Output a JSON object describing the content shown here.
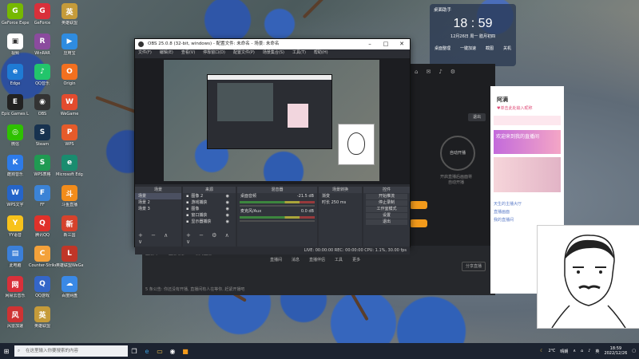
{
  "desktop_icons": [
    {
      "label": "GeForce Experience",
      "color": "#76b900",
      "glyph": "G"
    },
    {
      "label": "GeForce",
      "color": "#d9303a",
      "glyph": "G"
    },
    {
      "label": "英雄联盟",
      "color": "#c59b3a",
      "glyph": "英"
    },
    {
      "label": "视频",
      "color": "#ffffff",
      "glyph": "▣"
    },
    {
      "label": "WinRAR",
      "color": "#8b4b9e",
      "glyph": "R"
    },
    {
      "label": "应用宝",
      "color": "#2f8ce0",
      "glyph": "▶"
    },
    {
      "label": "Edge",
      "color": "#1f7bd4",
      "glyph": "e"
    },
    {
      "label": "QQ音乐",
      "color": "#22c56b",
      "glyph": "♪"
    },
    {
      "label": "Origin",
      "color": "#f3701f",
      "glyph": "O"
    },
    {
      "label": "Epic Games Launcher",
      "color": "#222222",
      "glyph": "E"
    },
    {
      "label": "OBS",
      "color": "#333333",
      "glyph": "◉"
    },
    {
      "label": "WeGame",
      "color": "#e34b2e",
      "glyph": "W"
    },
    {
      "label": "微信",
      "color": "#2ec100",
      "glyph": "◎"
    },
    {
      "label": "Steam",
      "color": "#17324f",
      "glyph": "S"
    },
    {
      "label": "WPS",
      "color": "#e65b2a",
      "glyph": "P"
    },
    {
      "label": "酷狗音乐",
      "color": "#2d7be8",
      "glyph": "K"
    },
    {
      "label": "WPS表格",
      "color": "#1f9a52",
      "glyph": "S"
    },
    {
      "label": "Microsoft Edge",
      "color": "#1a8c6f",
      "glyph": "e"
    },
    {
      "label": "WPS文字",
      "color": "#2565c9",
      "glyph": "W"
    },
    {
      "label": "FF",
      "color": "#3b83d6",
      "glyph": "F"
    },
    {
      "label": "斗鱼直播",
      "color": "#f28c1b",
      "glyph": "斗"
    },
    {
      "label": "YY语音",
      "color": "#f7c21b",
      "glyph": "Y"
    },
    {
      "label": "腾讯QQ",
      "color": "#e0312a",
      "glyph": "Q"
    },
    {
      "label": "新三国",
      "color": "#d5422c",
      "glyph": "新"
    },
    {
      "label": "此电脑",
      "color": "#3b7fd8",
      "glyph": "▤"
    },
    {
      "label": "Counter-Strike",
      "color": "#f3a13a",
      "glyph": "C"
    },
    {
      "label": "英雄联盟WeGame版",
      "color": "#c03628",
      "glyph": "L"
    },
    {
      "label": "网易云音乐",
      "color": "#d9303a",
      "glyph": "网"
    },
    {
      "label": "QQ游戏",
      "color": "#3466c8",
      "glyph": "Q"
    },
    {
      "label": "百度网盘",
      "color": "#3a89e6",
      "glyph": "☁"
    },
    {
      "label": "风雷加速",
      "color": "#ce3333",
      "glyph": "风"
    },
    {
      "label": "英雄联盟",
      "color": "#c59b3a",
      "glyph": "英"
    }
  ],
  "obs": {
    "title": "OBS 25.0.8 (32-bit, windows) - 配置文件: 未命名 - 场景: 未命名",
    "menu": [
      "文件(F)",
      "编辑(E)",
      "查看(V)",
      "停靠窗口(D)",
      "配置文件(P)",
      "场景集合(S)",
      "工具(T)",
      "帮助(H)"
    ],
    "docks": {
      "scenes_header": "场景",
      "scenes": [
        "场景",
        "场景 2",
        "场景 3"
      ],
      "sources_header": "来源",
      "sources": [
        "图像 2",
        "游戏捕获",
        "图像",
        "窗口捕获",
        "显示器捕获"
      ],
      "mixer_header": "混音器",
      "mixer": [
        {
          "name": "桌面音频",
          "db": "-21.5 dB"
        },
        {
          "name": "麦克风/Aux",
          "db": "0.0 dB"
        }
      ],
      "transition_header": "场景转换",
      "transition_fade": "渐变",
      "transition_duration_label": "时长",
      "transition_duration": "250 ms",
      "controls_header": "控件",
      "controls": [
        "开始推流",
        "停止录制",
        "工作室模式",
        "设置",
        "退出"
      ]
    },
    "status": "LIVE: 00:00:00   REC: 00:00:00   CPU: 1.1%, 30.00 fps"
  },
  "stream_app": {
    "button_auto": "自动开播",
    "hint": "开启直播后画面将\n自动开播",
    "button_right": "退出",
    "bottom_tools": [
      "直播间",
      "消息",
      "直播伴侣",
      "工具",
      "更多"
    ],
    "bottom_right": "分享直播",
    "left_bar": [
      "直播间",
      "直播动态",
      "我的直播"
    ],
    "status_bar": "5 条公告: 你还没有开播, 直播间有人在等你, 赶紧开播吧"
  },
  "chat": {
    "title": "阿满",
    "subtitle": "♥单击此处输入昵称",
    "banner": "欢迎来到我的直播间",
    "list": [
      "天生的主播大厅",
      "直播画面",
      "我的直播间"
    ]
  },
  "clock": {
    "title": "桌面助手",
    "time": "18 : 59",
    "date": "12月26日  周一  腊月初四",
    "actions": [
      "桌面整理",
      "一键加速",
      "截图",
      "关机"
    ]
  },
  "taskbar": {
    "search_placeholder": "在这里输入你要搜索的内容",
    "temp": "2℃",
    "weather": "晴朗",
    "time": "18:59",
    "date": "2022/12/26",
    "lang": "英"
  }
}
